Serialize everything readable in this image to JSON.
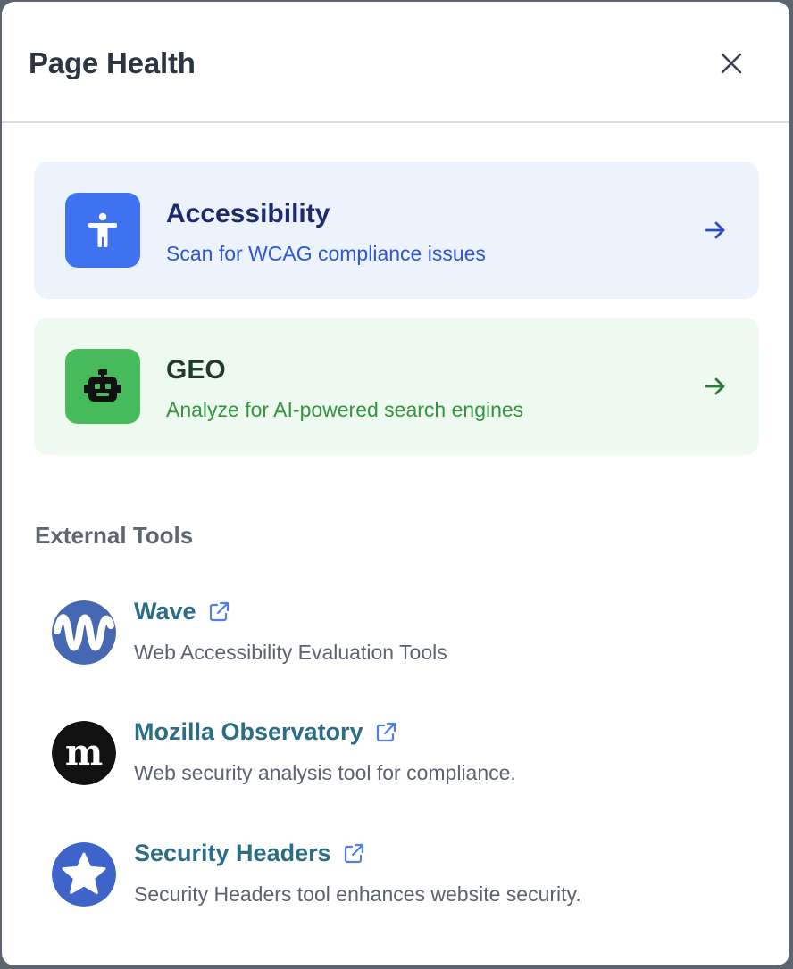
{
  "header": {
    "title": "Page Health"
  },
  "cards": [
    {
      "title": "Accessibility",
      "description": "Scan for WCAG compliance issues",
      "icon": "accessibility-icon",
      "accent": "#3f72f0"
    },
    {
      "title": "GEO",
      "description": "Analyze for AI-powered search engines",
      "icon": "robot-icon",
      "accent": "#47bb5c"
    }
  ],
  "external": {
    "title": "External Tools",
    "tools": [
      {
        "name": "Wave",
        "description": "Web Accessibility Evaluation Tools",
        "icon": "wave-logo"
      },
      {
        "name": "Mozilla Observatory",
        "description": "Web security analysis tool for compliance.",
        "icon": "mozilla-logo"
      },
      {
        "name": "Security Headers",
        "description": "Security Headers tool enhances website security.",
        "icon": "star-logo"
      }
    ]
  }
}
